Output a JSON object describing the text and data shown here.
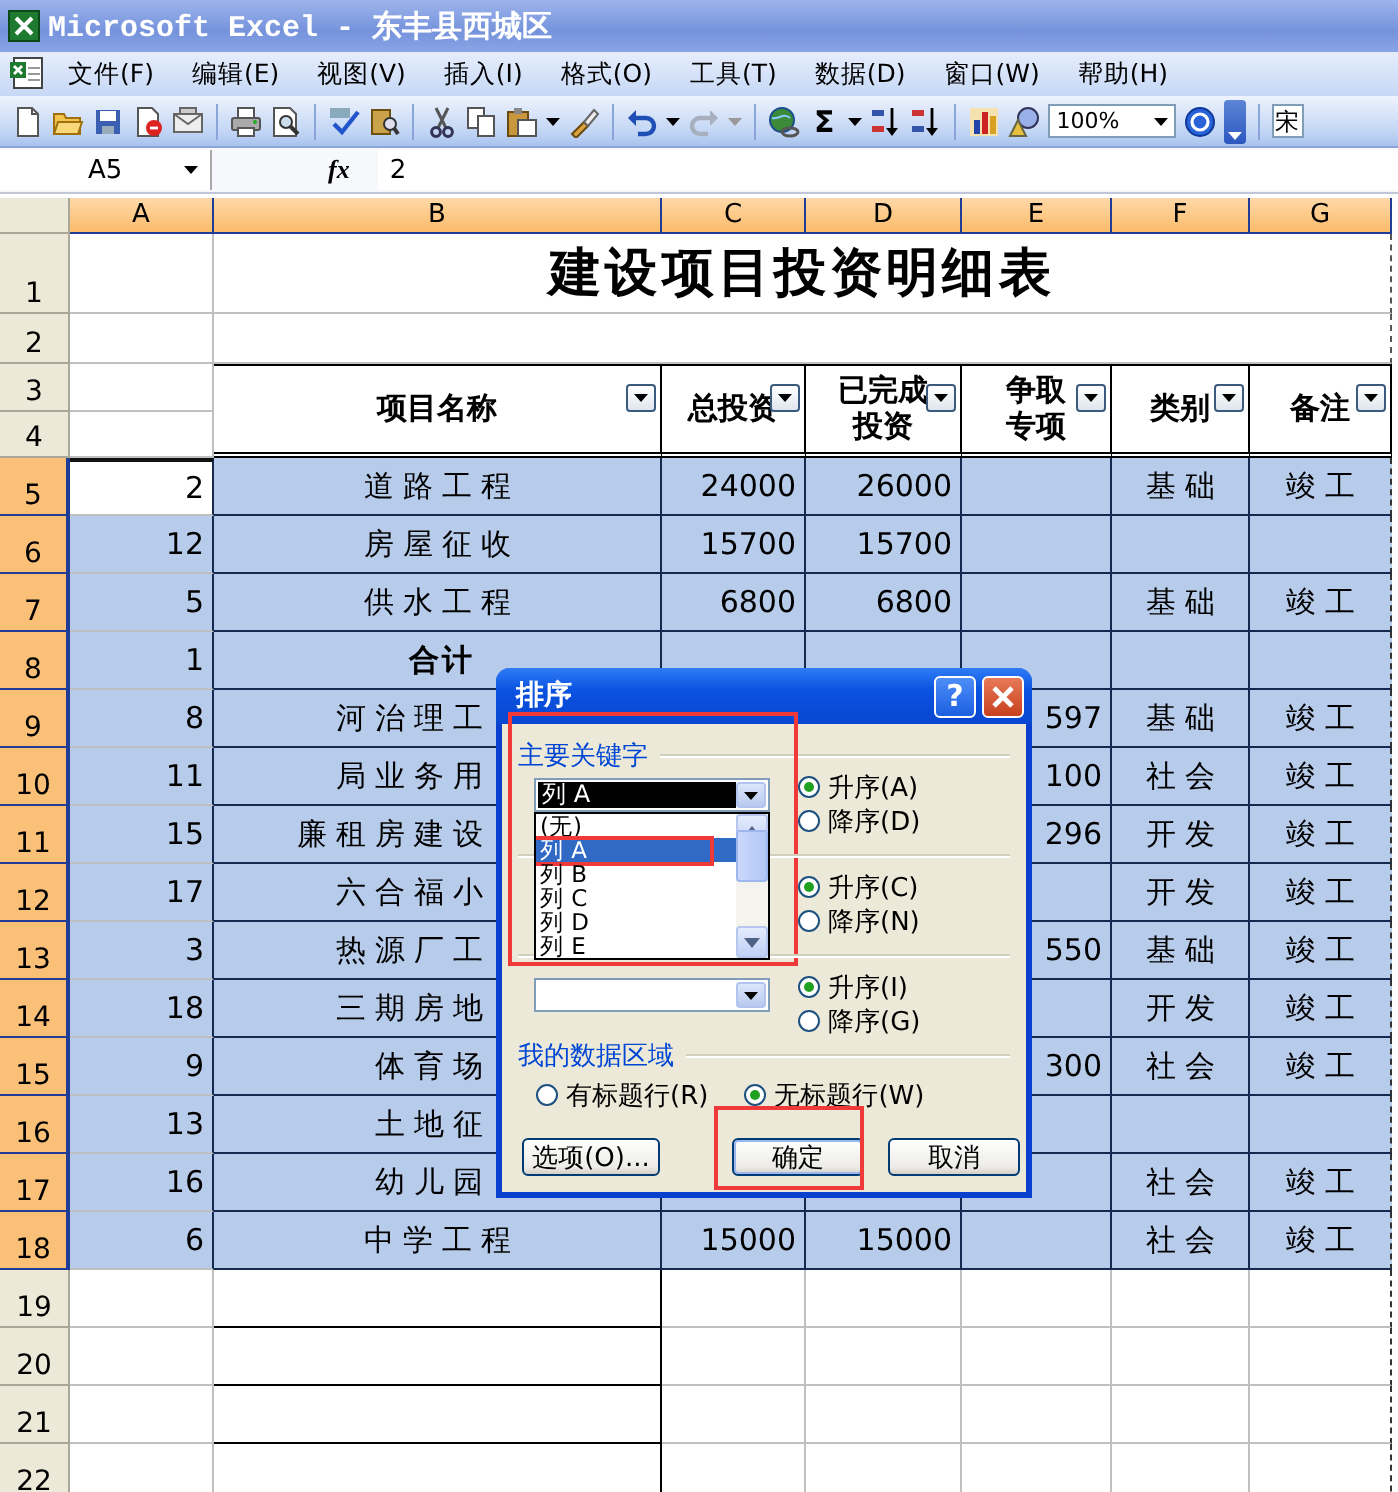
{
  "window": {
    "title": "Microsoft Excel - 东丰县西城区"
  },
  "menu": [
    "文件(F)",
    "编辑(E)",
    "视图(V)",
    "插入(I)",
    "格式(O)",
    "工具(T)",
    "数据(D)",
    "窗口(W)",
    "帮助(H)"
  ],
  "toolbar": {
    "redo": {
      "disabled": true
    },
    "autosum": "Σ",
    "zoom": "100%",
    "font": "宋"
  },
  "formula_bar": {
    "name_box": "A5",
    "function_label": "fx",
    "value": "2"
  },
  "sheet": {
    "columns": [
      {
        "label": "A",
        "selected": true
      },
      {
        "label": "B",
        "selected": true
      },
      {
        "label": "C",
        "selected": true
      },
      {
        "label": "D",
        "selected": true
      },
      {
        "label": "E",
        "selected": true
      },
      {
        "label": "F",
        "selected": true
      },
      {
        "label": "G",
        "selected": true
      }
    ],
    "title": "建设项目投资明细表",
    "top_rows": [
      {
        "header": "1",
        "selected": false
      },
      {
        "header": "2",
        "selected": false
      },
      {
        "header": "3",
        "selected": false
      },
      {
        "header": "4",
        "selected": false
      }
    ],
    "table_headers": [
      {
        "label": "项目名称"
      },
      {
        "label": "总投资"
      },
      {
        "label": "已完成投资"
      },
      {
        "label": "争取专项"
      },
      {
        "label": "类别"
      },
      {
        "label": "备注"
      }
    ],
    "rows": [
      {
        "header": "5",
        "selected": true,
        "active": true,
        "kind": "item",
        "cells": {
          "A": "2",
          "B": "道路工程",
          "C": "24000",
          "D": "26000",
          "F": "基础",
          "G": "竣工"
        }
      },
      {
        "header": "6",
        "selected": true,
        "active": false,
        "kind": "item",
        "cells": {
          "A": "12",
          "B": "房屋征收",
          "C": "15700",
          "D": "15700"
        }
      },
      {
        "header": "7",
        "selected": true,
        "active": false,
        "kind": "item",
        "cells": {
          "A": "5",
          "B": "供水工程",
          "C": "6800",
          "D": "6800",
          "F": "基础",
          "G": "竣工"
        }
      },
      {
        "header": "8",
        "selected": true,
        "active": false,
        "kind": "total",
        "cells": {
          "A": "1",
          "B": "合计"
        }
      },
      {
        "header": "9",
        "selected": true,
        "active": false,
        "kind": "item",
        "cells": {
          "A": "8",
          "B": "河治理工",
          "E": "597",
          "F": "基础",
          "G": "竣工"
        }
      },
      {
        "header": "10",
        "selected": true,
        "active": false,
        "kind": "item",
        "cells": {
          "A": "11",
          "B": "局业务用",
          "E": "100",
          "F": "社会",
          "G": "竣工"
        }
      },
      {
        "header": "11",
        "selected": true,
        "active": false,
        "kind": "item",
        "cells": {
          "A": "15",
          "B": "廉租房建设",
          "E": "296",
          "F": "开发",
          "G": "竣工"
        }
      },
      {
        "header": "12",
        "selected": true,
        "active": false,
        "kind": "item",
        "cells": {
          "A": "17",
          "B": "六合福小",
          "F": "开发",
          "G": "竣工"
        }
      },
      {
        "header": "13",
        "selected": true,
        "active": false,
        "kind": "item",
        "cells": {
          "A": "3",
          "B": "热源厂工",
          "E": "550",
          "F": "基础",
          "G": "竣工"
        }
      },
      {
        "header": "14",
        "selected": true,
        "active": false,
        "kind": "item",
        "cells": {
          "A": "18",
          "B": "三期房地",
          "F": "开发",
          "G": "竣工"
        }
      },
      {
        "header": "15",
        "selected": true,
        "active": false,
        "kind": "item",
        "cells": {
          "A": "9",
          "B": "体育场",
          "E": "300",
          "F": "社会",
          "G": "竣工"
        }
      },
      {
        "header": "16",
        "selected": true,
        "active": false,
        "kind": "item",
        "cells": {
          "A": "13",
          "B": "土地征"
        }
      },
      {
        "header": "17",
        "selected": true,
        "active": false,
        "kind": "item",
        "cells": {
          "A": "16",
          "B": "幼儿园",
          "F": "社会",
          "G": "竣工"
        }
      },
      {
        "header": "18",
        "selected": true,
        "active": false,
        "kind": "item",
        "cells": {
          "A": "6",
          "B": "中学工程",
          "C": "15000",
          "D": "15000",
          "F": "社会",
          "G": "竣工"
        }
      },
      {
        "header": "19",
        "selected": false,
        "active": false,
        "kind": "item",
        "cells": {}
      },
      {
        "header": "20",
        "selected": false,
        "active": false,
        "kind": "item",
        "cells": {}
      },
      {
        "header": "21",
        "selected": false,
        "active": false,
        "kind": "item",
        "cells": {}
      },
      {
        "header": "22",
        "selected": false,
        "active": false,
        "kind": "item",
        "cells": {}
      }
    ]
  },
  "dialog": {
    "title": "排序",
    "help": "?",
    "sections": [
      {
        "label": "主要关键字",
        "highlighted": true,
        "combo": {
          "value": "列 A",
          "focused": true
        },
        "radios": [
          {
            "label": "升序(A)",
            "selected": true
          },
          {
            "label": "降序(D)",
            "selected": false
          }
        ]
      },
      {
        "radios": [
          {
            "label": "升序(C)",
            "selected": true
          },
          {
            "label": "降序(N)",
            "selected": false
          }
        ]
      },
      {
        "combo": {
          "focused": false
        },
        "radios": [
          {
            "label": "升序(I)",
            "selected": true
          },
          {
            "label": "降序(G)",
            "selected": false
          }
        ]
      },
      {
        "label": "我的数据区域",
        "radios": [
          {
            "label": "有标题行(R)",
            "selected": false
          },
          {
            "label": "无标题行(W)",
            "selected": true
          }
        ]
      }
    ],
    "dropdown": [
      {
        "label": "(无)",
        "selected": false
      },
      {
        "label": "列 A",
        "selected": true,
        "highlighted": true
      },
      {
        "label": "列 B",
        "selected": false
      },
      {
        "label": "列 C",
        "selected": false
      },
      {
        "label": "列 D",
        "selected": false
      },
      {
        "label": "列 E",
        "selected": false
      }
    ],
    "buttons": [
      {
        "label": "选项(O)...",
        "default": false
      },
      {
        "label": "确定",
        "default": true,
        "highlighted": true
      },
      {
        "label": "取消",
        "default": false
      }
    ]
  }
}
